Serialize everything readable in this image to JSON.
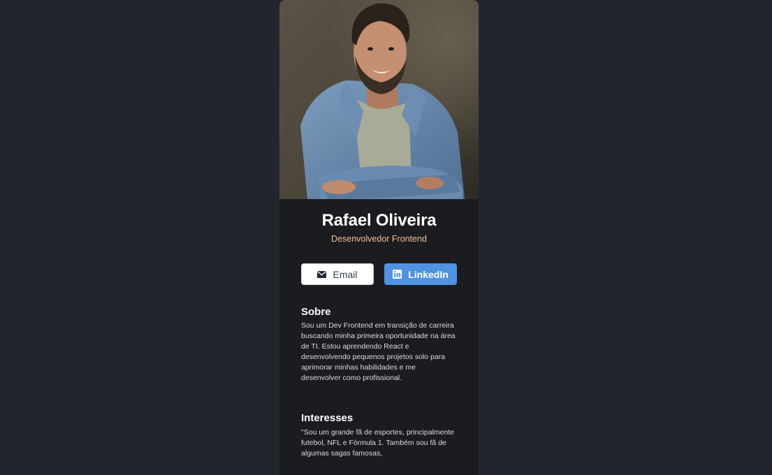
{
  "profile": {
    "name": "Rafael Oliveira",
    "role": "Desenvolvedor Frontend"
  },
  "buttons": {
    "email_label": "Email",
    "email_icon": "mail-icon",
    "linkedin_label": "LinkedIn",
    "linkedin_icon": "linkedin-icon"
  },
  "about": {
    "title": "Sobre",
    "text": "Sou um Dev Frontend em transição de carreira buscando minha primeira oportunidade na área de TI. Estou aprendendo React e desenvolvendo pequenos projetos solo para aprimorar minhas habilidades e me desenvolver como profissional."
  },
  "interests": {
    "title": "Interesses",
    "text": "\"Sou um grande fã de esportes, principalmente futebol, NFL e Fórmula 1. Também sou fã de algumas sagas famosas,"
  },
  "colors": {
    "page_bg": "#23252e",
    "card_bg": "#1b1c20",
    "accent_role": "#f3bf99",
    "linkedin_blue": "#5093e1"
  }
}
